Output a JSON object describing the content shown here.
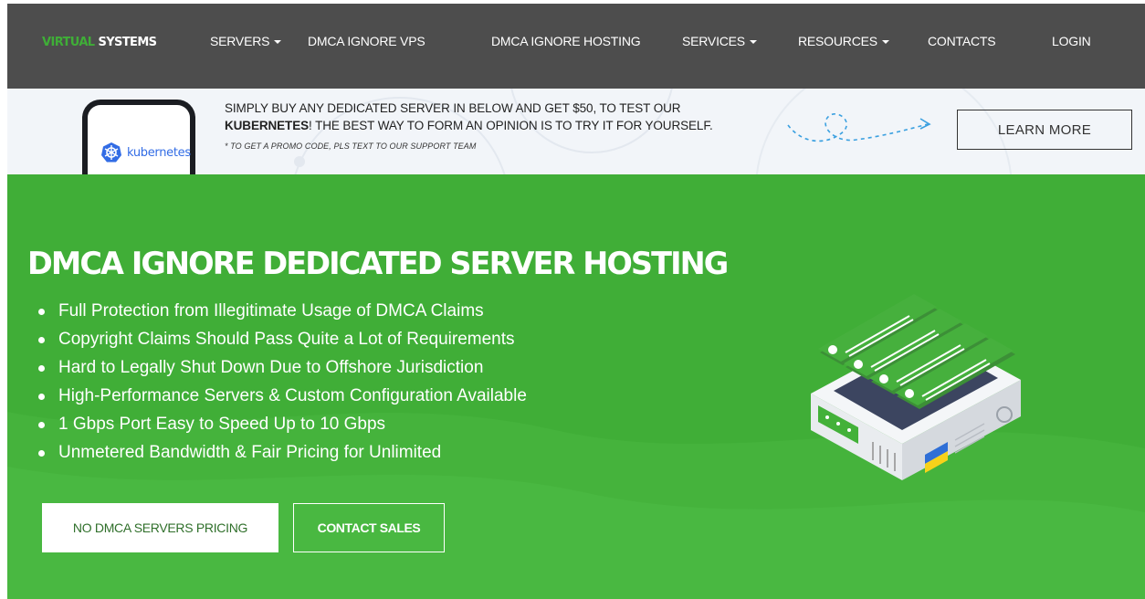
{
  "brand": {
    "part1": "VIRTUAL",
    "part2": "SYSTEMS",
    "accent": "#3fae37"
  },
  "nav": {
    "items": [
      {
        "label": "SERVERS",
        "dropdown": true
      },
      {
        "label": "DMCA IGNORE VPS",
        "dropdown": false
      },
      {
        "label": "DMCA IGNORE HOSTING",
        "dropdown": false
      },
      {
        "label": "SERVICES",
        "dropdown": true
      },
      {
        "label": "RESOURCES",
        "dropdown": true
      },
      {
        "label": "CONTACTS",
        "dropdown": false
      },
      {
        "label": "LOGIN",
        "dropdown": false
      }
    ],
    "background": "#4d4d4d"
  },
  "promo": {
    "phone_text": "kubernetes",
    "line1": "SIMPLY BUY ANY DEDICATED SERVER IN BELOW AND GET $50, TO TEST OUR",
    "line2_bold": "KUBERNETES",
    "line2_rest": "! THE BEST WAY TO FORM AN OPINION IS TO TRY IT FOR YOURSELF.",
    "note": "* TO GET A PROMO CODE, PLS TEXT TO OUR SUPPORT TEAM",
    "button": "LEARN MORE"
  },
  "hero": {
    "title": "DMCA IGNORE DEDICATED SERVER HOSTING",
    "bullets": [
      "Full Protection from Illegitimate Usage of DMCA Claims",
      "Copyright Claims Should Pass Quite a Lot of Requirements",
      "Hard to Legally Shut Down Due to Offshore Jurisdiction",
      "High-Performance Servers & Custom Configuration Available",
      "1 Gbps Port Easy to Speed Up to 10 Gbps",
      "Unmetered Bandwidth & Fair Pricing for Unlimited"
    ],
    "primary_button": "NO DMCA SERVERS PRICING",
    "secondary_button": "CONTACT SALES",
    "background": "#40ae37"
  },
  "icons": [
    "kubernetes-icon",
    "dotted-arrow-icon",
    "server-rack-illustration",
    "ukraine-flag-icon"
  ]
}
